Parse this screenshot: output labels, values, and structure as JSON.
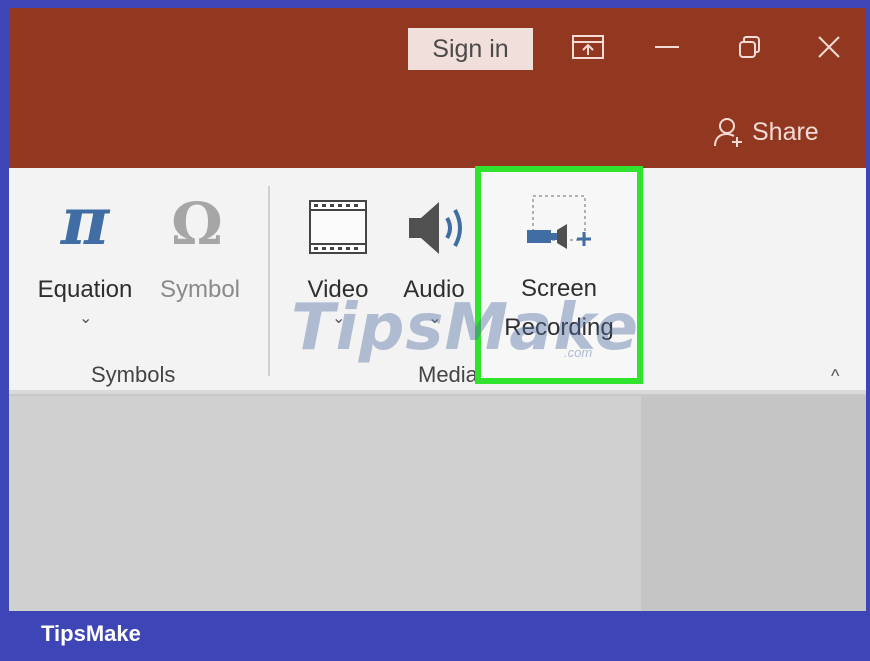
{
  "titlebar": {
    "sign_in_label": "Sign in",
    "share_label": "Share",
    "icons": [
      "ribbon-display-options-icon",
      "minimize-icon",
      "restore-icon",
      "close-icon",
      "person-add-icon"
    ]
  },
  "ribbon": {
    "groups": [
      {
        "label": "Symbols",
        "buttons": [
          {
            "label": "Equation",
            "icon": "pi-icon",
            "caret": "⌄"
          },
          {
            "label": "Symbol",
            "icon": "omega-icon"
          }
        ]
      },
      {
        "label": "Media",
        "buttons": [
          {
            "label": "Video",
            "icon": "film-icon",
            "caret": "⌄"
          },
          {
            "label": "Audio",
            "icon": "speaker-icon",
            "caret": "⌄"
          },
          {
            "label_line1": "Screen",
            "label_line2": "Recording",
            "icon": "screen-recording-icon",
            "highlighted": true
          }
        ]
      }
    ],
    "collapse_caret": "^"
  },
  "watermark": {
    "text": "TipsMake",
    "suffix": ".com"
  },
  "footer": {
    "brand": "TipsMake"
  },
  "colors": {
    "frame": "#3e45b6",
    "titlebar": "#933820",
    "ribbon": "#f3f3f3",
    "highlight": "#2fe32f",
    "equation_icon": "#3f6da4"
  }
}
